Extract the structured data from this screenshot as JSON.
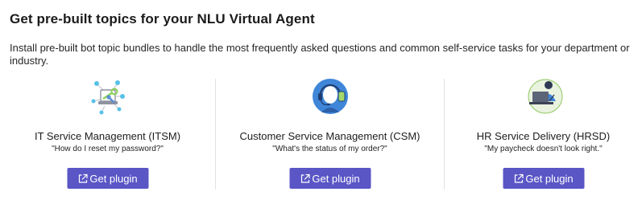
{
  "header": {
    "title": "Get pre-built topics for your NLU Virtual Agent",
    "subtitle": "Install pre-built bot topic bundles to handle the most frequently asked questions and common self-service tasks for your department or industry."
  },
  "cards": [
    {
      "title": "IT Service Management (ITSM)",
      "quote": "\"How do I reset my password?\"",
      "button_label": "Get plugin",
      "icon": "it-network-icon"
    },
    {
      "title": "Customer Service Management (CSM)",
      "quote": "\"What's the status of my order?\"",
      "button_label": "Get plugin",
      "icon": "headset-agent-icon"
    },
    {
      "title": "HR Service Delivery (HRSD)",
      "quote": "\"My paycheck doesn't look right.\"",
      "button_label": "Get plugin",
      "icon": "hr-person-laptop-icon"
    }
  ],
  "colors": {
    "button": "#5a56c6",
    "divider": "#e2e2e2"
  }
}
